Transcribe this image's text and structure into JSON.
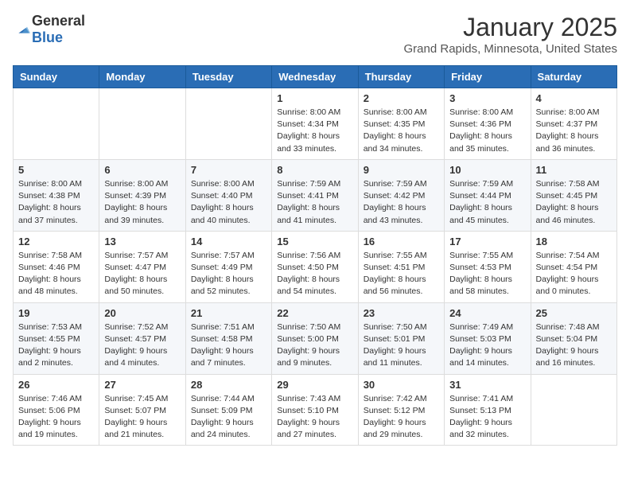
{
  "header": {
    "logo": {
      "general": "General",
      "blue": "Blue"
    },
    "title": "January 2025",
    "location": "Grand Rapids, Minnesota, United States"
  },
  "calendar": {
    "days_of_week": [
      "Sunday",
      "Monday",
      "Tuesday",
      "Wednesday",
      "Thursday",
      "Friday",
      "Saturday"
    ],
    "weeks": [
      [
        {
          "day": "",
          "info": ""
        },
        {
          "day": "",
          "info": ""
        },
        {
          "day": "",
          "info": ""
        },
        {
          "day": "1",
          "info": "Sunrise: 8:00 AM\nSunset: 4:34 PM\nDaylight: 8 hours\nand 33 minutes."
        },
        {
          "day": "2",
          "info": "Sunrise: 8:00 AM\nSunset: 4:35 PM\nDaylight: 8 hours\nand 34 minutes."
        },
        {
          "day": "3",
          "info": "Sunrise: 8:00 AM\nSunset: 4:36 PM\nDaylight: 8 hours\nand 35 minutes."
        },
        {
          "day": "4",
          "info": "Sunrise: 8:00 AM\nSunset: 4:37 PM\nDaylight: 8 hours\nand 36 minutes."
        }
      ],
      [
        {
          "day": "5",
          "info": "Sunrise: 8:00 AM\nSunset: 4:38 PM\nDaylight: 8 hours\nand 37 minutes."
        },
        {
          "day": "6",
          "info": "Sunrise: 8:00 AM\nSunset: 4:39 PM\nDaylight: 8 hours\nand 39 minutes."
        },
        {
          "day": "7",
          "info": "Sunrise: 8:00 AM\nSunset: 4:40 PM\nDaylight: 8 hours\nand 40 minutes."
        },
        {
          "day": "8",
          "info": "Sunrise: 7:59 AM\nSunset: 4:41 PM\nDaylight: 8 hours\nand 41 minutes."
        },
        {
          "day": "9",
          "info": "Sunrise: 7:59 AM\nSunset: 4:42 PM\nDaylight: 8 hours\nand 43 minutes."
        },
        {
          "day": "10",
          "info": "Sunrise: 7:59 AM\nSunset: 4:44 PM\nDaylight: 8 hours\nand 45 minutes."
        },
        {
          "day": "11",
          "info": "Sunrise: 7:58 AM\nSunset: 4:45 PM\nDaylight: 8 hours\nand 46 minutes."
        }
      ],
      [
        {
          "day": "12",
          "info": "Sunrise: 7:58 AM\nSunset: 4:46 PM\nDaylight: 8 hours\nand 48 minutes."
        },
        {
          "day": "13",
          "info": "Sunrise: 7:57 AM\nSunset: 4:47 PM\nDaylight: 8 hours\nand 50 minutes."
        },
        {
          "day": "14",
          "info": "Sunrise: 7:57 AM\nSunset: 4:49 PM\nDaylight: 8 hours\nand 52 minutes."
        },
        {
          "day": "15",
          "info": "Sunrise: 7:56 AM\nSunset: 4:50 PM\nDaylight: 8 hours\nand 54 minutes."
        },
        {
          "day": "16",
          "info": "Sunrise: 7:55 AM\nSunset: 4:51 PM\nDaylight: 8 hours\nand 56 minutes."
        },
        {
          "day": "17",
          "info": "Sunrise: 7:55 AM\nSunset: 4:53 PM\nDaylight: 8 hours\nand 58 minutes."
        },
        {
          "day": "18",
          "info": "Sunrise: 7:54 AM\nSunset: 4:54 PM\nDaylight: 9 hours\nand 0 minutes."
        }
      ],
      [
        {
          "day": "19",
          "info": "Sunrise: 7:53 AM\nSunset: 4:55 PM\nDaylight: 9 hours\nand 2 minutes."
        },
        {
          "day": "20",
          "info": "Sunrise: 7:52 AM\nSunset: 4:57 PM\nDaylight: 9 hours\nand 4 minutes."
        },
        {
          "day": "21",
          "info": "Sunrise: 7:51 AM\nSunset: 4:58 PM\nDaylight: 9 hours\nand 7 minutes."
        },
        {
          "day": "22",
          "info": "Sunrise: 7:50 AM\nSunset: 5:00 PM\nDaylight: 9 hours\nand 9 minutes."
        },
        {
          "day": "23",
          "info": "Sunrise: 7:50 AM\nSunset: 5:01 PM\nDaylight: 9 hours\nand 11 minutes."
        },
        {
          "day": "24",
          "info": "Sunrise: 7:49 AM\nSunset: 5:03 PM\nDaylight: 9 hours\nand 14 minutes."
        },
        {
          "day": "25",
          "info": "Sunrise: 7:48 AM\nSunset: 5:04 PM\nDaylight: 9 hours\nand 16 minutes."
        }
      ],
      [
        {
          "day": "26",
          "info": "Sunrise: 7:46 AM\nSunset: 5:06 PM\nDaylight: 9 hours\nand 19 minutes."
        },
        {
          "day": "27",
          "info": "Sunrise: 7:45 AM\nSunset: 5:07 PM\nDaylight: 9 hours\nand 21 minutes."
        },
        {
          "day": "28",
          "info": "Sunrise: 7:44 AM\nSunset: 5:09 PM\nDaylight: 9 hours\nand 24 minutes."
        },
        {
          "day": "29",
          "info": "Sunrise: 7:43 AM\nSunset: 5:10 PM\nDaylight: 9 hours\nand 27 minutes."
        },
        {
          "day": "30",
          "info": "Sunrise: 7:42 AM\nSunset: 5:12 PM\nDaylight: 9 hours\nand 29 minutes."
        },
        {
          "day": "31",
          "info": "Sunrise: 7:41 AM\nSunset: 5:13 PM\nDaylight: 9 hours\nand 32 minutes."
        },
        {
          "day": "",
          "info": ""
        }
      ]
    ]
  }
}
